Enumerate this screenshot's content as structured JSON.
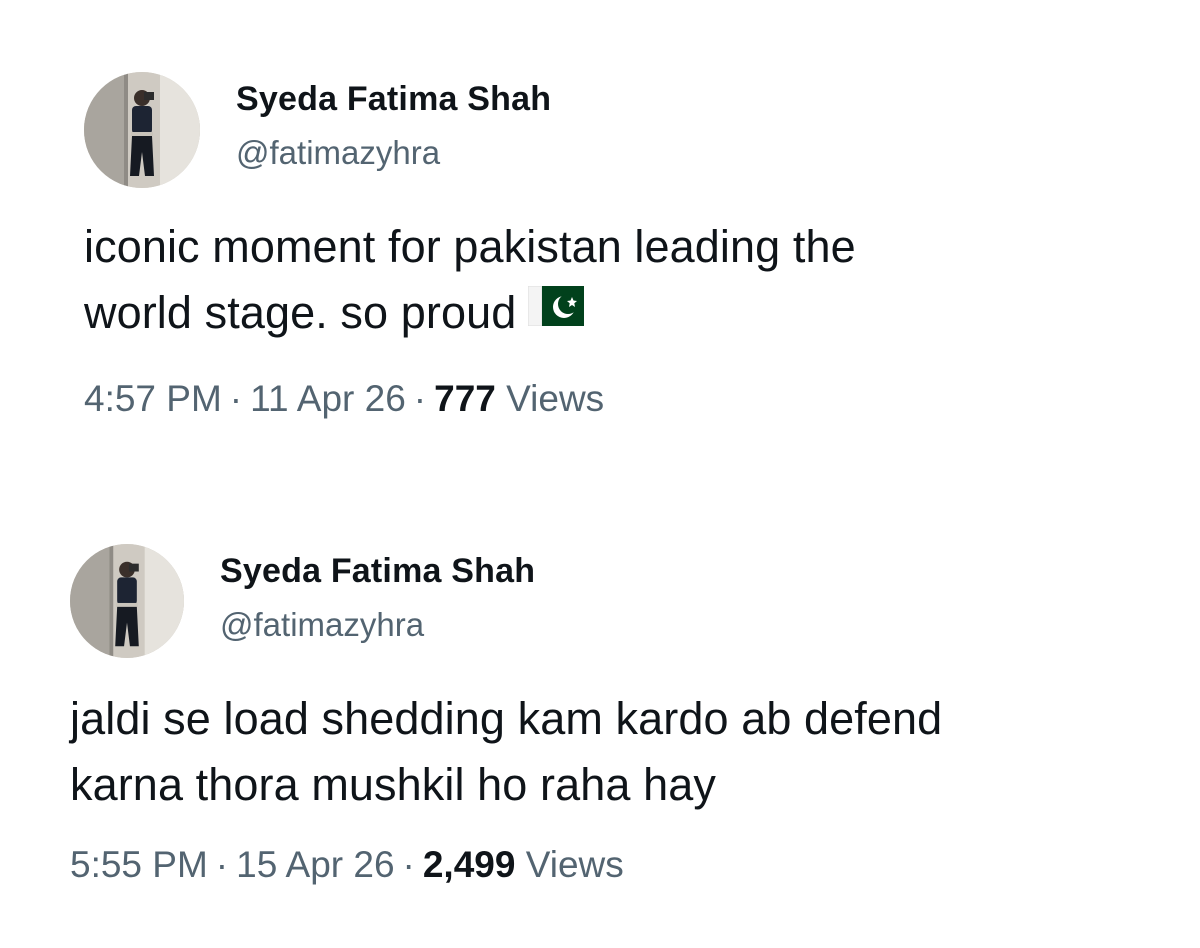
{
  "tweets": [
    {
      "author": {
        "name": "Syeda Fatima Shah",
        "handle": "@fatimazyhra",
        "avatar_icon": "profile-photo"
      },
      "text_lines": [
        "iconic moment for pakistan leading the",
        "world stage. so proud"
      ],
      "emoji": "pakistan-flag",
      "time": "4:57 PM",
      "date": "11 Apr 26",
      "separator": "·",
      "views_count": "777",
      "views_label": "Views"
    },
    {
      "author": {
        "name": "Syeda Fatima Shah",
        "handle": "@fatimazyhra",
        "avatar_icon": "profile-photo"
      },
      "text_lines": [
        "jaldi se load shedding kam kardo ab defend",
        "karna thora mushkil ho raha hay"
      ],
      "time": "5:55 PM",
      "date": "15 Apr 26",
      "separator": "·",
      "views_count": "2,499",
      "views_label": "Views"
    }
  ],
  "colors": {
    "text_primary": "#0f1419",
    "text_secondary": "#536471",
    "flag_green": "#01411c"
  }
}
